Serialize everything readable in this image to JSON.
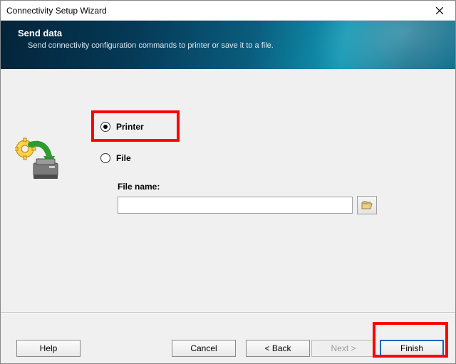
{
  "window": {
    "title": "Connectivity Setup Wizard"
  },
  "banner": {
    "heading": "Send data",
    "subheading": "Send connectivity configuration commands to printer or save it to a file."
  },
  "form": {
    "options": {
      "printer": {
        "label": "Printer",
        "selected": true
      },
      "file": {
        "label": "File",
        "selected": false
      }
    },
    "file_name_label": "File name:",
    "file_name_value": ""
  },
  "buttons": {
    "help": "Help",
    "cancel": "Cancel",
    "back": "<  Back",
    "next": "Next  >",
    "finish": "Finish"
  }
}
